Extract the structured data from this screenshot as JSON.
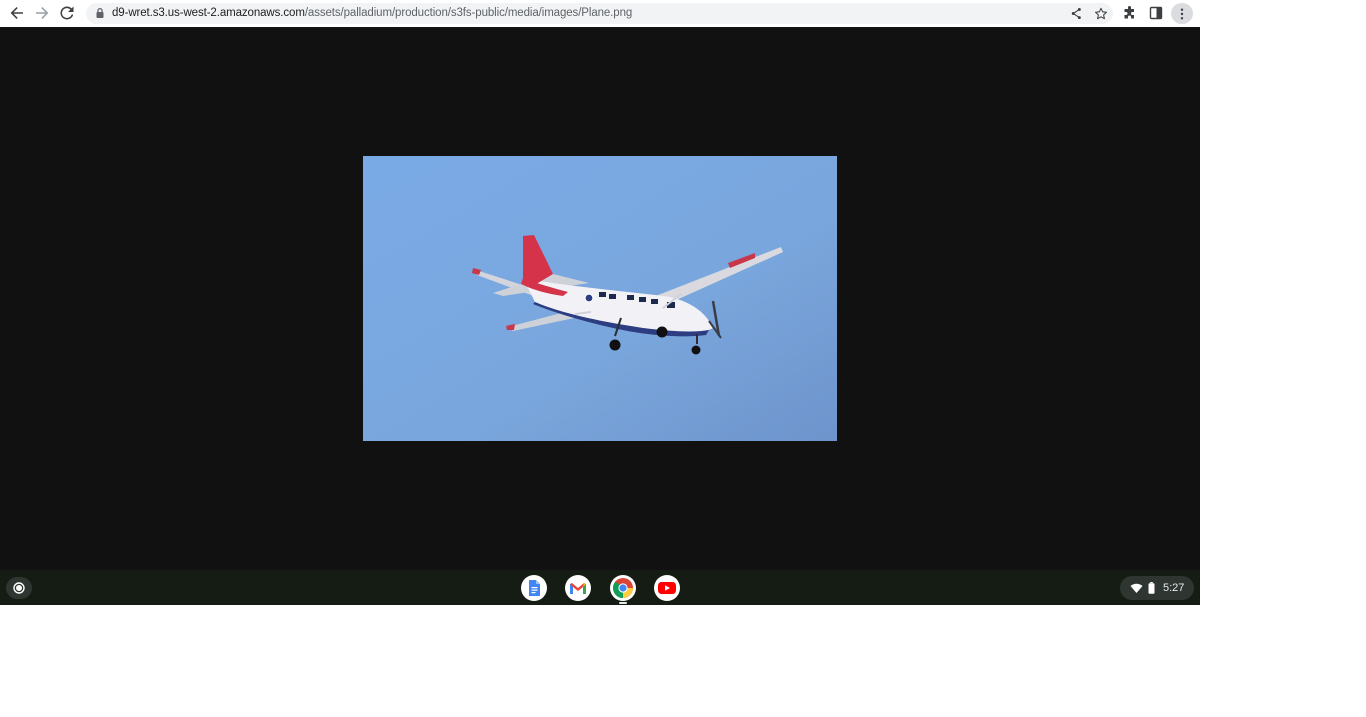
{
  "browser": {
    "url_host": "d9-wret.s3.us-west-2.amazonaws.com",
    "url_path": "/assets/palladium/production/s3fs-public/media/images/Plane.png",
    "icons": [
      "back-arrow-icon",
      "forward-arrow-icon",
      "reload-icon",
      "lock-icon",
      "share-icon",
      "star-icon",
      "extensions-icon",
      "side-panel-icon",
      "more-vert-icon"
    ]
  },
  "viewer": {
    "background": "#111111",
    "image_subject": "plane-photo",
    "sky_color": "#7aa8e0"
  },
  "shelf": {
    "apps": [
      "docs-app-icon",
      "gmail-app-icon",
      "chrome-app-icon",
      "youtube-app-icon"
    ],
    "active_app": "chrome-app-icon",
    "clock": "5:27",
    "background": "#141c13"
  }
}
